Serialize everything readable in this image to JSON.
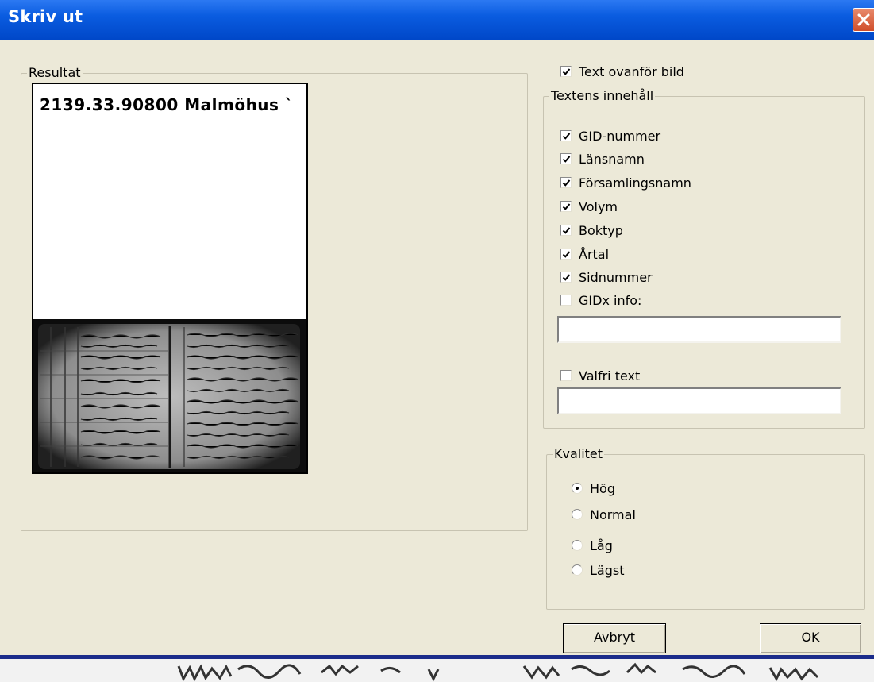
{
  "window": {
    "title": "Skriv ut"
  },
  "result": {
    "legend": "Resultat",
    "preview_text": "2139.33.90800  Malmöhus `"
  },
  "options": {
    "text_above_image": {
      "label": "Text ovanför bild",
      "checked": true
    }
  },
  "text_content": {
    "legend": "Textens innehåll",
    "items": [
      {
        "label": "GID-nummer",
        "checked": true
      },
      {
        "label": "Länsnamn",
        "checked": true
      },
      {
        "label": "Församlingsnamn",
        "checked": true
      },
      {
        "label": "Volym",
        "checked": true
      },
      {
        "label": "Boktyp",
        "checked": true
      },
      {
        "label": "Årtal",
        "checked": true
      },
      {
        "label": "Sidnummer",
        "checked": true
      },
      {
        "label": "GIDx info:",
        "checked": false
      }
    ],
    "gidx_value": "",
    "free_text": {
      "label": "Valfri text",
      "checked": false
    },
    "free_text_value": ""
  },
  "quality": {
    "legend": "Kvalitet",
    "options": [
      "Hög",
      "Normal",
      "Låg",
      "Lägst"
    ],
    "selected": "Hög"
  },
  "buttons": {
    "cancel": "Avbryt",
    "ok": "OK"
  },
  "colors": {
    "titlebar": "#0054e3",
    "dialog_bg": "#ece9d8",
    "close_button": "#d8583a"
  }
}
